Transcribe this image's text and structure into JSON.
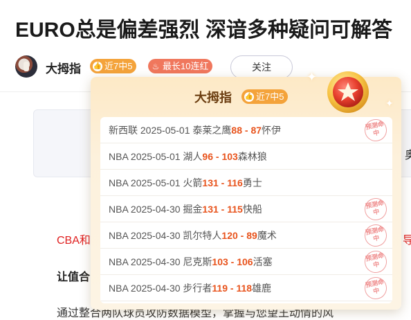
{
  "article": {
    "title": "EURO总是偏差强烈 深谙多种疑问可解答",
    "author": {
      "name": "大拇指",
      "badge_recent": "近7中5",
      "badge_streak": "最长10连红",
      "follow_label": "关注"
    },
    "gray_box_char": "奥",
    "red_text_left": "CBA和",
    "red_text_right": "导",
    "bold_line": "让值合",
    "body_line": "通过整合两队球员攻防数据模型，掌握与您望王动情的风",
    "colors": {
      "accent": "#f4a33b",
      "streak": "#f0775d",
      "score": "#e8531c",
      "link_red": "#e02020"
    }
  },
  "popup": {
    "name": "大拇指",
    "badge": "近7中5",
    "icons": [
      "thumb-icon",
      "medal-icon",
      "sparkle-icon"
    ],
    "stamp_text": "预测命中",
    "records": [
      {
        "league": "新西联",
        "date": "2025-05-01",
        "home": "泰莱之鹰",
        "home_score": "88",
        "sep": " - ",
        "away_score": "87",
        "away": "怀伊",
        "hit": true
      },
      {
        "league": "NBA",
        "date": "2025-05-01",
        "home": "湖人",
        "home_score": "96",
        "sep": " - ",
        "away_score": "103",
        "away": "森林狼",
        "hit": false
      },
      {
        "league": "NBA",
        "date": "2025-05-01",
        "home": "火箭",
        "home_score": "131",
        "sep": " - ",
        "away_score": "116",
        "away": "勇士",
        "hit": false
      },
      {
        "league": "NBA",
        "date": "2025-04-30",
        "home": "掘金",
        "home_score": "131",
        "sep": " - ",
        "away_score": "115",
        "away": "快船",
        "hit": true
      },
      {
        "league": "NBA",
        "date": "2025-04-30",
        "home": "凯尔特人",
        "home_score": "120",
        "sep": " - ",
        "away_score": "89",
        "away": "魔术",
        "hit": true
      },
      {
        "league": "NBA",
        "date": "2025-04-30",
        "home": "尼克斯",
        "home_score": "103",
        "sep": " - ",
        "away_score": "106",
        "away": "活塞",
        "hit": true
      },
      {
        "league": "NBA",
        "date": "2025-04-30",
        "home": "步行者",
        "home_score": "119",
        "sep": " - ",
        "away_score": "118",
        "away": "雄鹿",
        "hit": true
      }
    ]
  }
}
